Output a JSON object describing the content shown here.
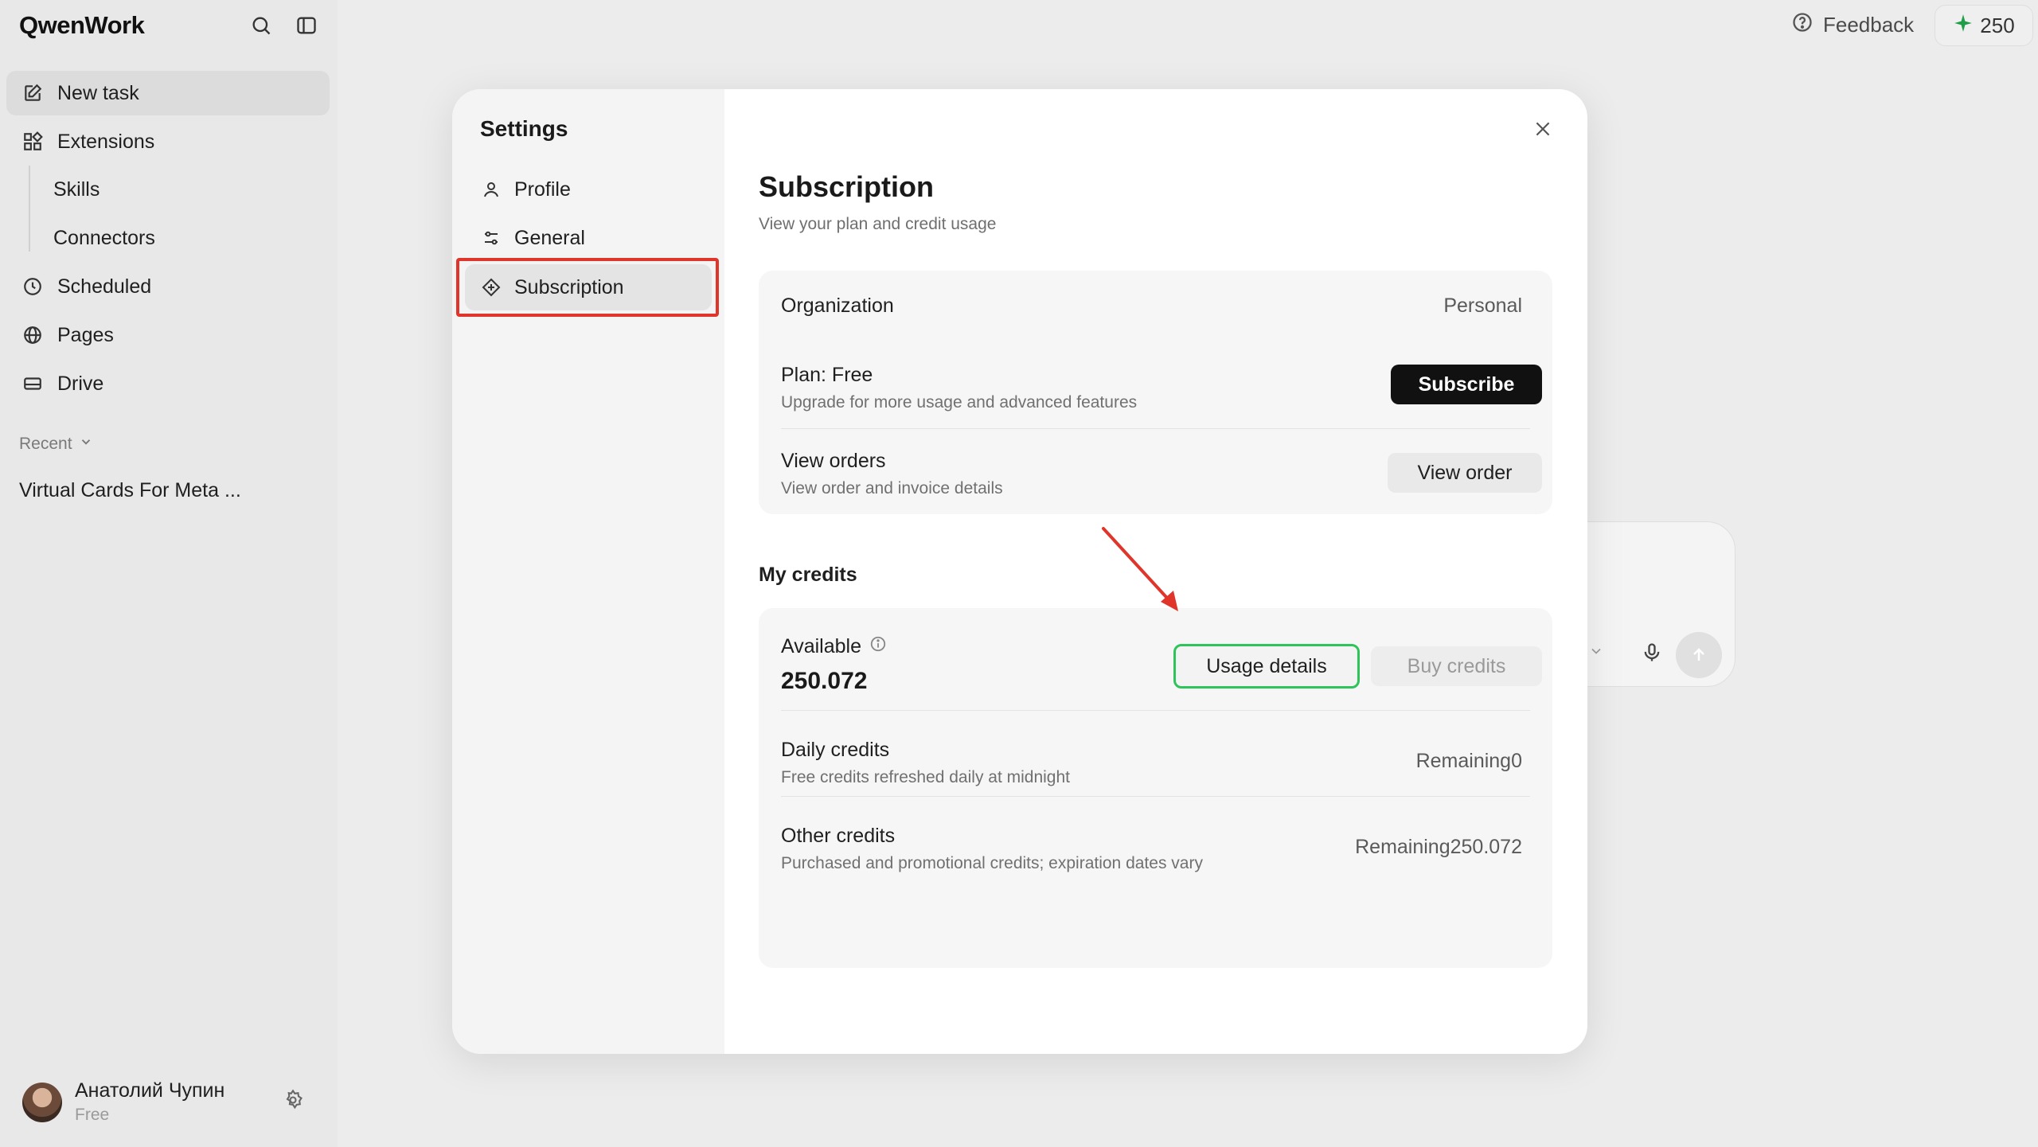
{
  "app": {
    "logo": "QwenWork",
    "header": {
      "feedback_label": "Feedback",
      "credits_count": "250"
    }
  },
  "sidebar": {
    "items": [
      {
        "label": "New task",
        "icon": "edit-icon"
      },
      {
        "label": "Extensions",
        "icon": "grid-icon"
      },
      {
        "label": "Scheduled",
        "icon": "clock-icon"
      },
      {
        "label": "Pages",
        "icon": "globe-icon"
      },
      {
        "label": "Drive",
        "icon": "drive-icon"
      }
    ],
    "sub_items": [
      "Skills",
      "Connectors"
    ],
    "recent_label": "Recent",
    "recent_items": [
      "Virtual Cards For Meta ..."
    ],
    "user": {
      "name": "Анатолий Чупин",
      "plan": "Free"
    }
  },
  "settings": {
    "title": "Settings",
    "nav": [
      {
        "label": "Profile",
        "icon": "person-icon"
      },
      {
        "label": "General",
        "icon": "sliders-icon"
      },
      {
        "label": "Subscription",
        "icon": "diamond-icon"
      }
    ],
    "subscription": {
      "title": "Subscription",
      "description": "View your plan and credit usage",
      "organization": {
        "label": "Organization",
        "value": "Personal"
      },
      "plan": {
        "label": "Plan: Free",
        "description": "Upgrade for more usage and advanced features",
        "button": "Subscribe"
      },
      "orders": {
        "label": "View orders",
        "description": "View order and invoice details",
        "button": "View order"
      },
      "credits": {
        "section_label": "My credits",
        "available_label": "Available",
        "available_value": "250.072",
        "usage_button": "Usage details",
        "buy_button": "Buy credits",
        "daily": {
          "label": "Daily credits",
          "description": "Free credits refreshed daily at midnight",
          "value": "Remaining0"
        },
        "other": {
          "label": "Other credits",
          "description": "Purchased and promotional credits; expiration dates vary",
          "value": "Remaining250.072"
        }
      }
    }
  },
  "colors": {
    "highlight": "#e0352b",
    "usage_border": "#2ec45a",
    "accent_green": "#1f9d49"
  }
}
